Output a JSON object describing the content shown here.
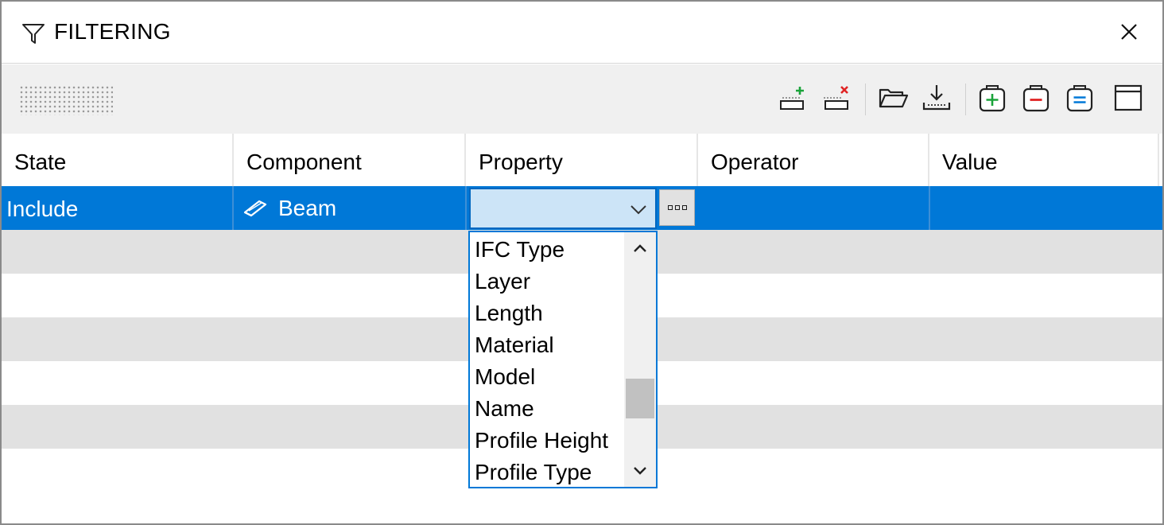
{
  "window": {
    "title": "FILTERING",
    "icons": {
      "title": "filter-icon",
      "close": "close-icon"
    }
  },
  "toolbar": {
    "buttons": [
      {
        "name": "add-row-icon",
        "accent": "#1aa33a"
      },
      {
        "name": "remove-row-icon",
        "accent": "#e02424"
      },
      {
        "name": "open-folder-icon"
      },
      {
        "name": "import-icon"
      },
      {
        "name": "add-group-icon",
        "accent": "#1aa33a"
      },
      {
        "name": "remove-group-icon",
        "accent": "#e02424"
      },
      {
        "name": "group-options-icon",
        "accent": "#0078d7"
      },
      {
        "name": "window-icon"
      }
    ]
  },
  "grid": {
    "columns": [
      "State",
      "Component",
      "Property",
      "Operator",
      "Value"
    ],
    "selected_row": {
      "state": "Include",
      "component": "Beam",
      "component_icon": "beam-icon",
      "property": "",
      "operator": "",
      "value": ""
    },
    "colors": {
      "selection": "#0078d7",
      "alt_row": "#e1e1e1"
    }
  },
  "property_dropdown": {
    "items": [
      "IFC Type",
      "Layer",
      "Length",
      "Material",
      "Model",
      "Name",
      "Profile Height",
      "Profile Type"
    ],
    "scroll_position": 0.62,
    "icons": {
      "up": "chevron-up-icon",
      "down": "chevron-down-icon"
    }
  }
}
